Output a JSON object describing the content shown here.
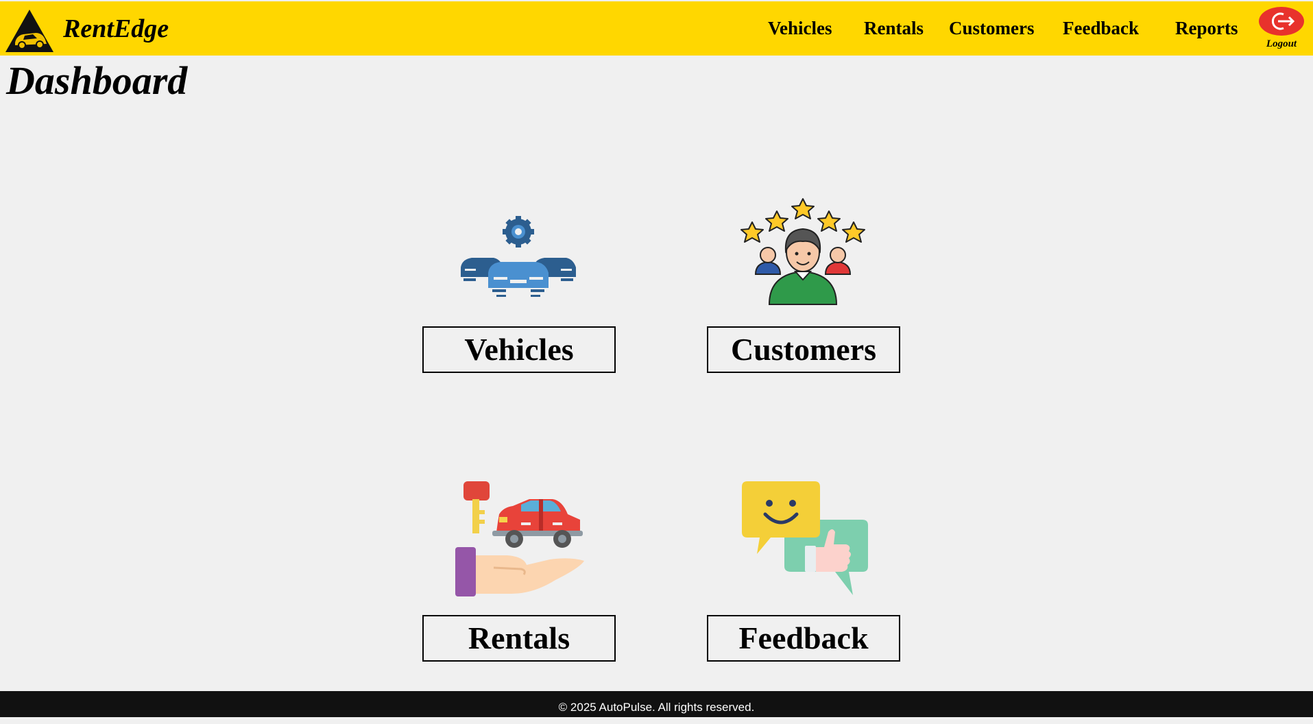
{
  "brand": {
    "name": "RentEdge",
    "logo_icon": "car-triangle-logo-icon"
  },
  "nav": {
    "items": [
      {
        "label": "Vehicles"
      },
      {
        "label": "Rentals"
      },
      {
        "label": "Customers"
      },
      {
        "label": "Feedback"
      },
      {
        "label": "Reports"
      }
    ],
    "logout": {
      "label": "Logout",
      "icon": "logout-icon",
      "color": "#e8322c"
    }
  },
  "page": {
    "title": "Dashboard"
  },
  "cards": [
    {
      "label": "Vehicles",
      "icon": "fleet-gear-icon"
    },
    {
      "label": "Customers",
      "icon": "customer-rating-icon"
    },
    {
      "label": "Rentals",
      "icon": "car-rental-hand-icon"
    },
    {
      "label": "Feedback",
      "icon": "feedback-chat-icon"
    }
  ],
  "footer": {
    "text": "© 2025 AutoPulse. All rights reserved."
  },
  "colors": {
    "navbar": "#ffd700",
    "background": "#f0f0f0",
    "footer": "#111111"
  }
}
